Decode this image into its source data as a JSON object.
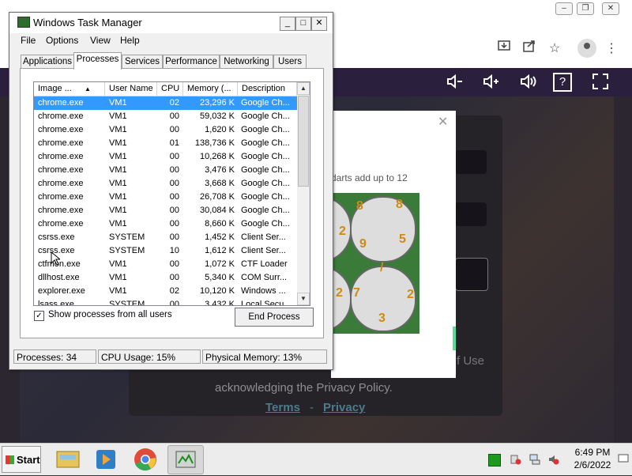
{
  "browser": {
    "window_controls": {
      "minimize": "‒",
      "restore": "❐",
      "close": "✕"
    },
    "toolbar_icons": [
      "download-icon",
      "share-icon",
      "star-icon",
      "profile-icon",
      "menu-icon"
    ],
    "site_controls": [
      "volume-down-icon",
      "volume-up-icon",
      "speaker-icon",
      "help-icon",
      "fullscreen-icon"
    ],
    "help_symbol": "?",
    "background_text": {
      "of_use": "f Use",
      "acknowledge": "acknowledging the Privacy Policy.",
      "terms": "Terms",
      "dash": "-",
      "privacy": "Privacy"
    },
    "captcha": {
      "close": "✕",
      "instruction": "darts add up to 12",
      "dial_numbers": [
        "8",
        "8",
        "2",
        "9",
        "5",
        "/",
        "2",
        "7",
        "2",
        "3"
      ]
    }
  },
  "task_manager": {
    "title": "Windows Task Manager",
    "title_buttons": {
      "minimize": "_",
      "maximize": "□",
      "close": "✕"
    },
    "menu": [
      "File",
      "Options",
      "View",
      "Help"
    ],
    "tabs": [
      "Applications",
      "Processes",
      "Services",
      "Performance",
      "Networking",
      "Users"
    ],
    "active_tab": "Processes",
    "columns": [
      "Image ...",
      "User Name",
      "CPU",
      "Memory (...",
      "Description"
    ],
    "sort_indicator": "▲",
    "rows": [
      {
        "image": "chrome.exe",
        "user": "VM1",
        "cpu": "02",
        "memory": "23,296 K",
        "desc": "Google Ch...",
        "selected": true
      },
      {
        "image": "chrome.exe",
        "user": "VM1",
        "cpu": "00",
        "memory": "59,032 K",
        "desc": "Google Ch..."
      },
      {
        "image": "chrome.exe",
        "user": "VM1",
        "cpu": "00",
        "memory": "1,620 K",
        "desc": "Google Ch..."
      },
      {
        "image": "chrome.exe",
        "user": "VM1",
        "cpu": "01",
        "memory": "138,736 K",
        "desc": "Google Ch..."
      },
      {
        "image": "chrome.exe",
        "user": "VM1",
        "cpu": "00",
        "memory": "10,268 K",
        "desc": "Google Ch..."
      },
      {
        "image": "chrome.exe",
        "user": "VM1",
        "cpu": "00",
        "memory": "3,476 K",
        "desc": "Google Ch..."
      },
      {
        "image": "chrome.exe",
        "user": "VM1",
        "cpu": "00",
        "memory": "3,668 K",
        "desc": "Google Ch..."
      },
      {
        "image": "chrome.exe",
        "user": "VM1",
        "cpu": "00",
        "memory": "26,708 K",
        "desc": "Google Ch..."
      },
      {
        "image": "chrome.exe",
        "user": "VM1",
        "cpu": "00",
        "memory": "30,084 K",
        "desc": "Google Ch..."
      },
      {
        "image": "chrome.exe",
        "user": "VM1",
        "cpu": "00",
        "memory": "8,660 K",
        "desc": "Google Ch..."
      },
      {
        "image": "csrss.exe",
        "user": "SYSTEM",
        "cpu": "00",
        "memory": "1,452 K",
        "desc": "Client Ser..."
      },
      {
        "image": "csrss.exe",
        "user": "SYSTEM",
        "cpu": "10",
        "memory": "1,612 K",
        "desc": "Client Ser..."
      },
      {
        "image": "ctfmon.exe",
        "user": "VM1",
        "cpu": "00",
        "memory": "1,072 K",
        "desc": "CTF Loader"
      },
      {
        "image": "dllhost.exe",
        "user": "VM1",
        "cpu": "00",
        "memory": "5,340 K",
        "desc": "COM Surr..."
      },
      {
        "image": "explorer.exe",
        "user": "VM1",
        "cpu": "02",
        "memory": "10,120 K",
        "desc": "Windows ..."
      },
      {
        "image": "lsass.exe",
        "user": "SYSTEM",
        "cpu": "00",
        "memory": "3,432 K",
        "desc": "Local Secu..."
      }
    ],
    "show_all_checked": "✓",
    "show_all_label": "Show processes from all users",
    "end_process_label": "End Process",
    "status": {
      "processes": "Processes: 34",
      "cpu": "CPU Usage: 15%",
      "memory": "Physical Memory: 13%"
    }
  },
  "taskbar": {
    "start_label": "Start",
    "apps": [
      "explorer-icon",
      "media-player-icon",
      "chrome-icon",
      "task-manager-icon"
    ],
    "clock_time": "6:49 PM",
    "clock_date": "2/6/2022"
  },
  "colors": {
    "selection": "#3399ff",
    "site_header": "#2a1f3d",
    "link": "#4d7b8c"
  }
}
